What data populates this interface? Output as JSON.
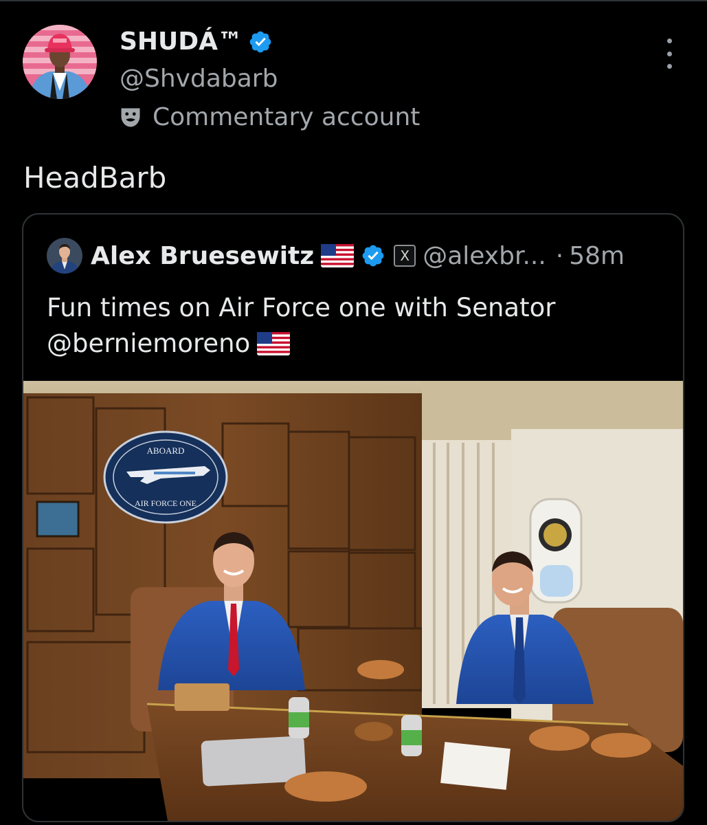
{
  "tweet": {
    "author_name": "SHUDÁ™",
    "author_handle": "@Shvdabarb",
    "account_label": "Commentary account",
    "text": "HeadBarb"
  },
  "quote": {
    "author_name": "Alex Bruesewitz",
    "author_handle": "@alexbr...",
    "separator": "·",
    "time": "58m",
    "text_line1": "Fun times on Air Force one with Senator",
    "text_line2": "@berniemoreno",
    "photo_sign_top": "ABOARD",
    "photo_sign_bottom": "AIR FORCE ONE",
    "affiliate_badge": "X"
  },
  "colors": {
    "background": "#000000",
    "primary_text": "#e7e9ea",
    "secondary_text": "#a2a7ac",
    "verified_blue": "#1d9bf0",
    "border": "#2f3336"
  },
  "icons": [
    "verified-badge-icon",
    "theater-masks-icon",
    "more-options-icon",
    "us-flag-icon",
    "x-affiliate-icon"
  ]
}
